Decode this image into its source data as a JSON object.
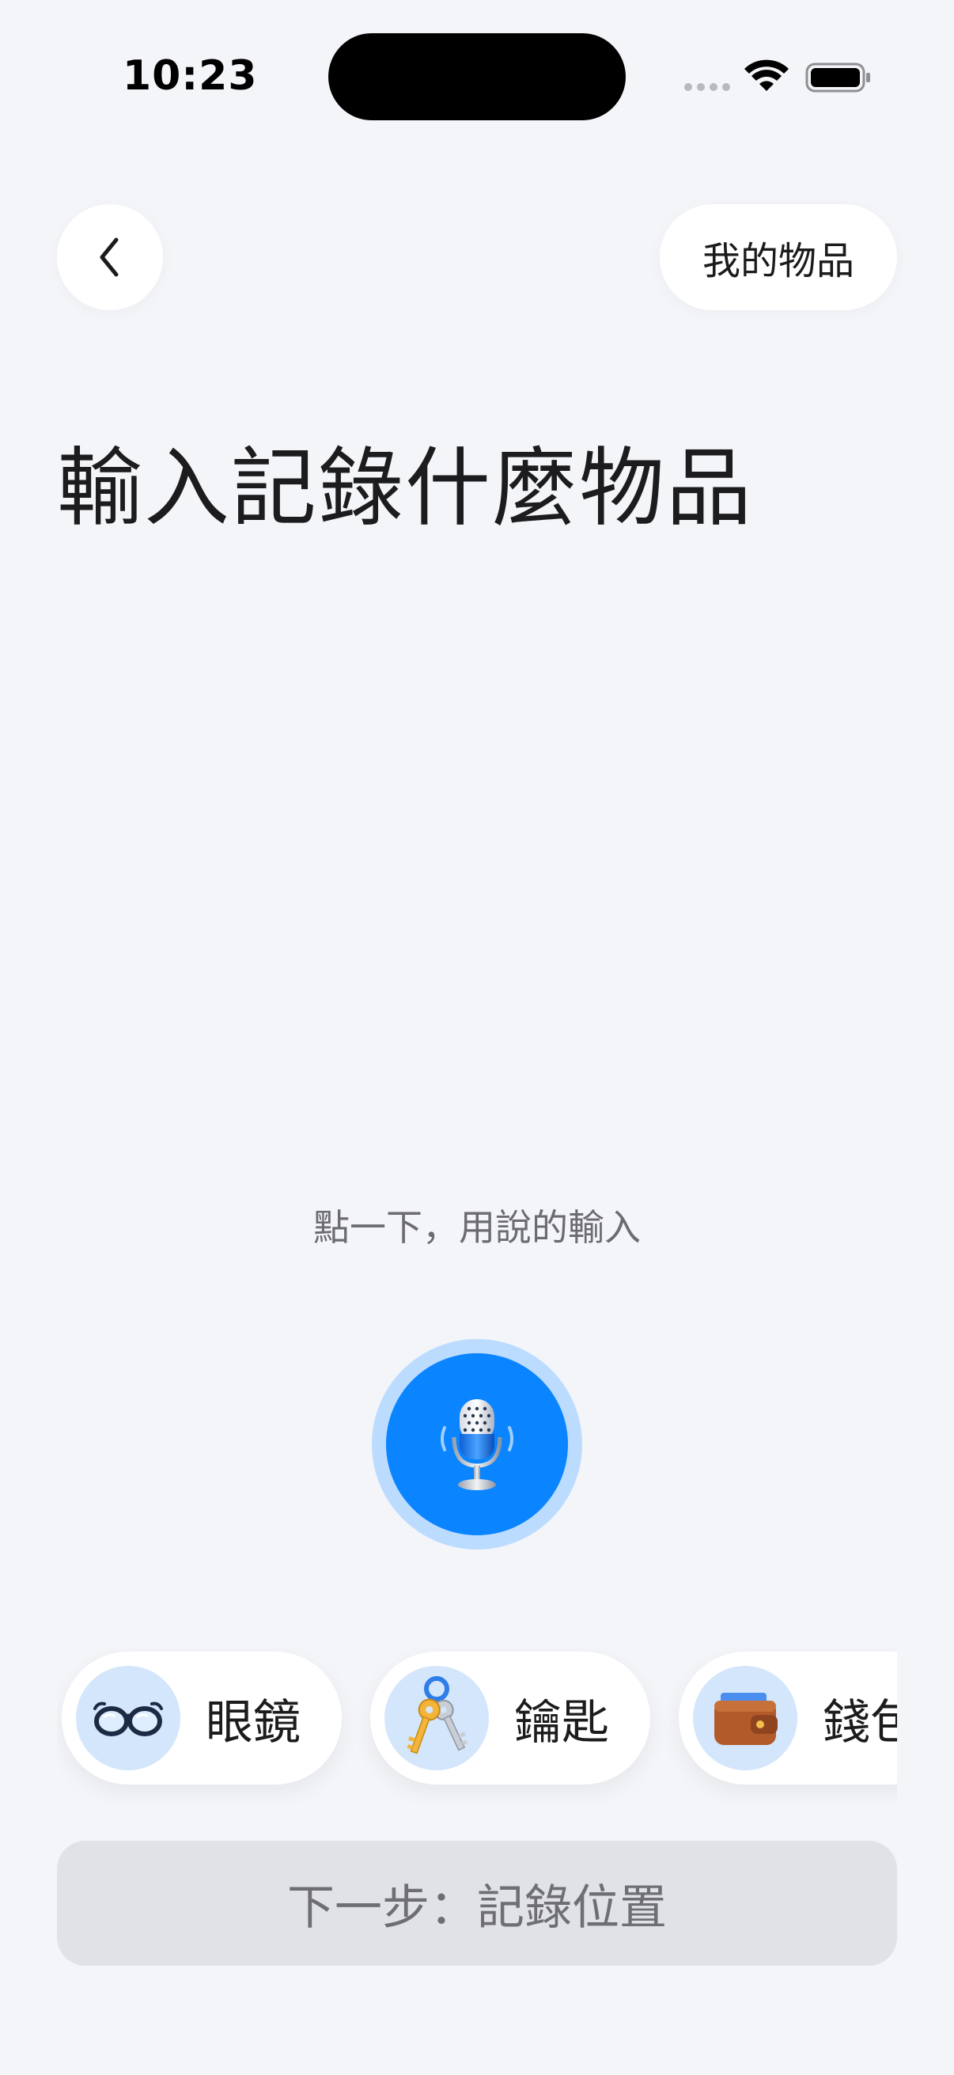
{
  "status_bar": {
    "time": "10:23"
  },
  "nav": {
    "back_icon": "chevron-left-icon",
    "my_items_label": "我的物品"
  },
  "title": "輸入記錄什麼物品",
  "voice": {
    "hint": "點一下，用說的輸入",
    "icon": "microphone-icon"
  },
  "suggestions": [
    {
      "label": "眼鏡",
      "icon": "glasses-icon"
    },
    {
      "label": "鑰匙",
      "icon": "keys-icon"
    },
    {
      "label": "錢包",
      "icon": "wallet-icon"
    }
  ],
  "next_button": {
    "label": "下一步：記錄位置"
  },
  "colors": {
    "background": "#f4f5f9",
    "accent": "#0a84ff",
    "accent_ring": "#bcdcff",
    "chip_icon_bg": "#d3e6fb",
    "disabled_button": "#e0e2e7"
  }
}
